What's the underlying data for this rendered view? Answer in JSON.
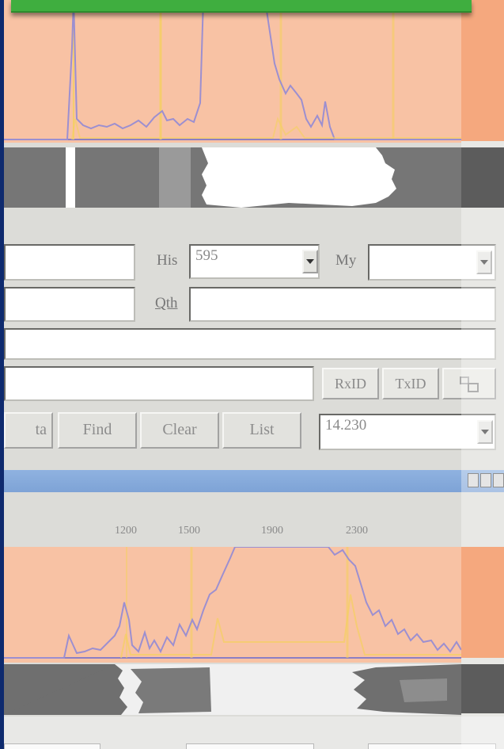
{
  "form": {
    "his_label": "His",
    "his_value": "595",
    "my_label": "My",
    "my_value": "",
    "qth_label": "Qth",
    "qth_value": "",
    "call_value": "",
    "name_value": "",
    "notes_value": "",
    "rxid_label": "RxID",
    "txid_label": "TxID",
    "extra_label": "ta",
    "find_label": "Find",
    "clear_label": "Clear",
    "list_label": "List",
    "freq_value": "14.230"
  },
  "scale": {
    "ticks": [
      "1200",
      "1500",
      "1900",
      "2300"
    ]
  },
  "colors": {
    "spectrum_bg": "#f8c2a4",
    "trace": "#9c8fd0",
    "marker": "#f5d060",
    "titlebar": "#7ea3d6",
    "accent_green": "#3fae3f"
  },
  "icons": {
    "dropdown": "chevron-down-icon",
    "window": "window-buttons-icon"
  }
}
